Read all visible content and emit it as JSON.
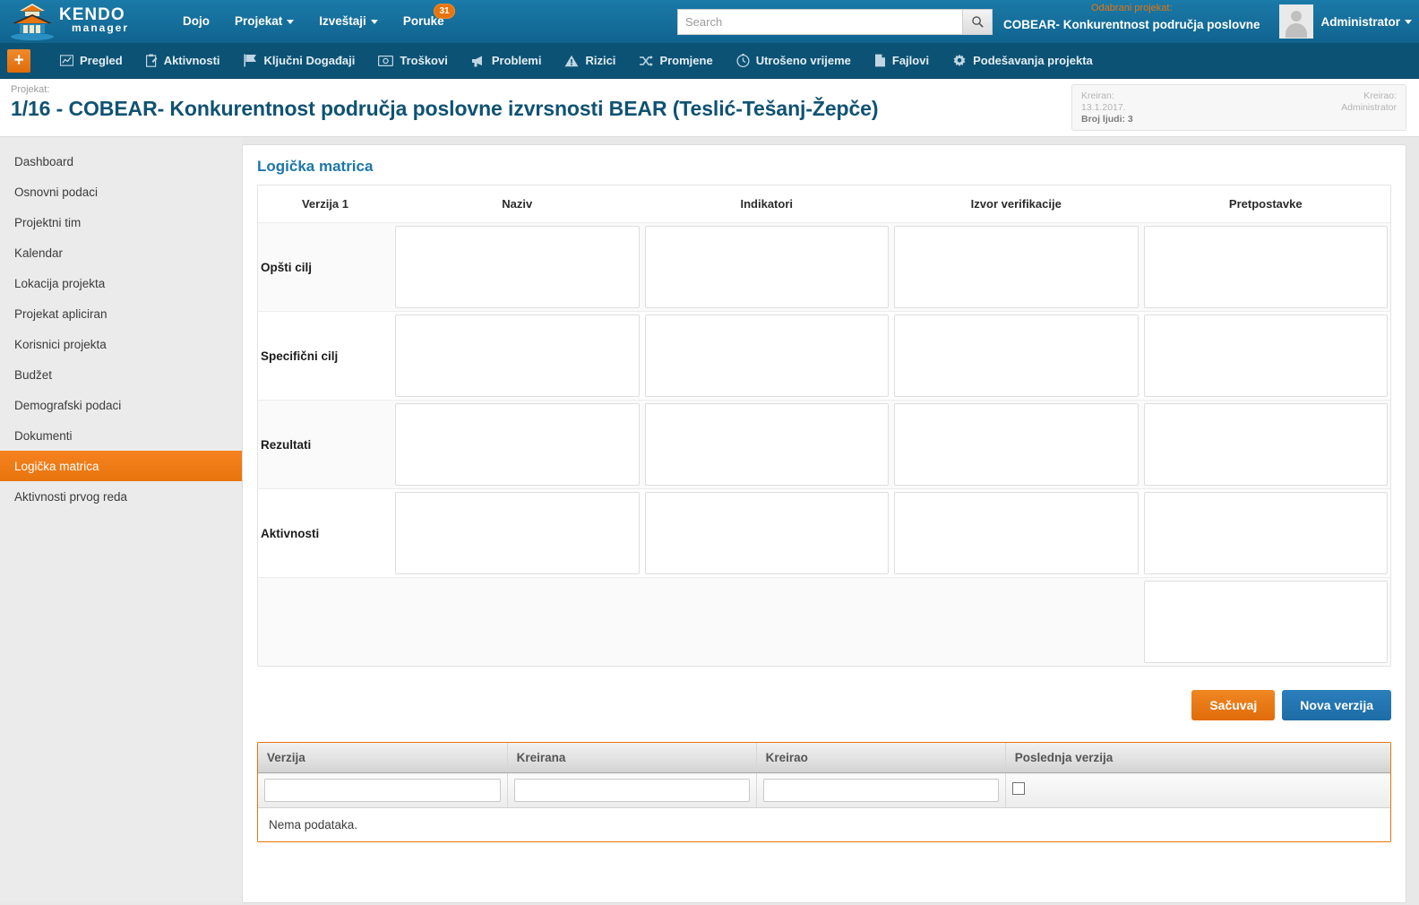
{
  "brand": {
    "name": "KENDO",
    "sub": "manager"
  },
  "topnav": {
    "items": [
      {
        "label": "Dojo",
        "caret": false,
        "badge": null
      },
      {
        "label": "Projekat",
        "caret": true,
        "badge": null
      },
      {
        "label": "Izveštaji",
        "caret": true,
        "badge": null
      },
      {
        "label": "Poruke",
        "caret": false,
        "badge": "31"
      }
    ]
  },
  "search": {
    "placeholder": "Search",
    "value": "",
    "icon": "search-icon"
  },
  "selected_project": {
    "label": "Odabrani projekat:",
    "name": "COBEAR- Konkurentnost područja poslovne",
    "label_color": "#e8740c"
  },
  "user": {
    "name": "Administrator",
    "avatar_icon": "user-avatar-icon"
  },
  "subnav": {
    "add_label": "+",
    "items": [
      {
        "label": "Pregled",
        "icon": "chart-icon"
      },
      {
        "label": "Aktivnosti",
        "icon": "clipboard-icon"
      },
      {
        "label": "Ključni Događaji",
        "icon": "flag-icon"
      },
      {
        "label": "Troškovi",
        "icon": "money-icon"
      },
      {
        "label": "Problemi",
        "icon": "megaphone-icon"
      },
      {
        "label": "Rizici",
        "icon": "warning-icon"
      },
      {
        "label": "Promjene",
        "icon": "shuffle-icon"
      },
      {
        "label": "Utrošeno vrijeme",
        "icon": "clock-icon"
      },
      {
        "label": "Fajlovi",
        "icon": "file-icon"
      },
      {
        "label": "Podešavanja projekta",
        "icon": "gear-icon"
      }
    ]
  },
  "project_header": {
    "kicker": "Projekat:",
    "title": "1/16 - COBEAR- Konkurentnost područja poslovne izvrsnosti BEAR (Teslić-Tešanj-Žepče)",
    "info": {
      "created_label": "Kreiran:",
      "created_value": "13.1.2017.",
      "people_label": "Broj ljudi: 3",
      "author_label": "Kreirao:",
      "author_value": "Administrator"
    }
  },
  "sidebar": {
    "items": [
      {
        "label": "Dashboard",
        "active": false
      },
      {
        "label": "Osnovni podaci",
        "active": false
      },
      {
        "label": "Projektni tim",
        "active": false
      },
      {
        "label": "Kalendar",
        "active": false
      },
      {
        "label": "Lokacija projekta",
        "active": false
      },
      {
        "label": "Projekat apliciran",
        "active": false
      },
      {
        "label": "Korisnici projekta",
        "active": false
      },
      {
        "label": "Budžet",
        "active": false
      },
      {
        "label": "Demografski podaci",
        "active": false
      },
      {
        "label": "Dokumenti",
        "active": false
      },
      {
        "label": "Logička matrica",
        "active": true
      },
      {
        "label": "Aktivnosti prvog reda",
        "active": false
      }
    ]
  },
  "main": {
    "title": "Logička matrica",
    "matrix": {
      "headers": [
        "Verzija 1",
        "Naziv",
        "Indikatori",
        "Izvor verifikacije",
        "Pretpostavke"
      ],
      "rows": [
        {
          "label": "Opšti cilj",
          "alt": true,
          "cells": [
            "",
            "",
            "",
            ""
          ],
          "cell_visible": [
            true,
            true,
            true,
            true
          ]
        },
        {
          "label": "Specifični cilj",
          "alt": false,
          "cells": [
            "",
            "",
            "",
            ""
          ],
          "cell_visible": [
            true,
            true,
            true,
            true
          ]
        },
        {
          "label": "Rezultati",
          "alt": true,
          "cells": [
            "",
            "",
            "",
            ""
          ],
          "cell_visible": [
            true,
            true,
            true,
            true
          ]
        },
        {
          "label": "Aktivnosti",
          "alt": false,
          "cells": [
            "",
            "",
            "",
            ""
          ],
          "cell_visible": [
            true,
            true,
            true,
            true
          ]
        },
        {
          "label": "",
          "alt": true,
          "cells": [
            "",
            "",
            "",
            ""
          ],
          "cell_visible": [
            false,
            false,
            false,
            true
          ]
        }
      ]
    },
    "actions": {
      "save_label": "Sačuvaj",
      "new_version_label": "Nova verzija"
    },
    "versions_grid": {
      "headers": [
        "Verzija",
        "Kreirana",
        "Kreirao",
        "Poslednja verzija"
      ],
      "filters": {
        "verzija": "",
        "kreirana": "",
        "kreirao": "",
        "poslednja_checked": false
      },
      "empty_text": "Nema podataka."
    }
  },
  "colors": {
    "accent_orange": "#e8740c",
    "header_blue": "#17719e",
    "subnav_blue": "#0c5274",
    "title_blue": "#0f5273",
    "panel_title_blue": "#1b77a8"
  }
}
